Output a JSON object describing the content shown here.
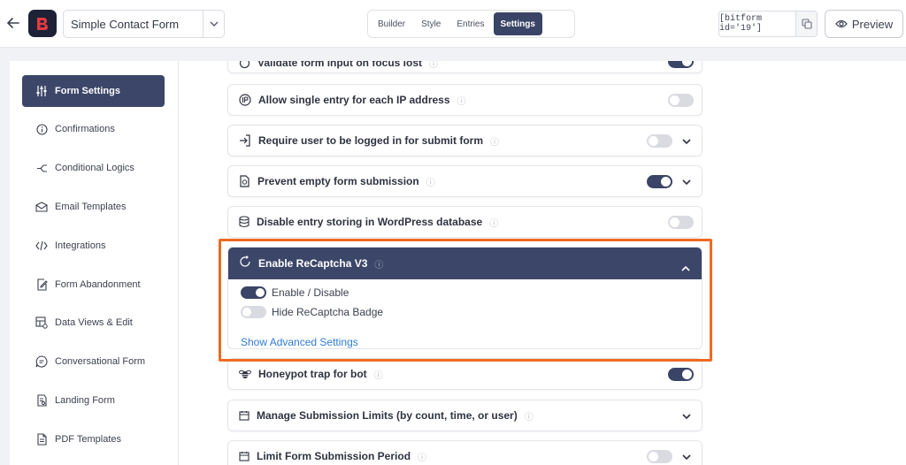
{
  "topbar": {
    "form_name": "Simple Contact Form",
    "tabs": [
      {
        "label": "Builder"
      },
      {
        "label": "Style"
      },
      {
        "label": "Entries"
      },
      {
        "label": "Settings"
      }
    ],
    "active_tab": "Settings",
    "shortcode": "[bitform id='19']",
    "preview_label": "Preview"
  },
  "sidebar": {
    "items": [
      {
        "label": "Form Settings",
        "icon": "sliders-icon"
      },
      {
        "label": "Confirmations",
        "icon": "info-circle-icon"
      },
      {
        "label": "Conditional Logics",
        "icon": "branch-icon"
      },
      {
        "label": "Email Templates",
        "icon": "envelope-icon"
      },
      {
        "label": "Integrations",
        "icon": "code-icon"
      },
      {
        "label": "Form Abandonment",
        "icon": "edit-doc-icon"
      },
      {
        "label": "Data Views & Edit",
        "icon": "table-edit-icon"
      },
      {
        "label": "Conversational Form",
        "icon": "chat-icon"
      },
      {
        "label": "Landing Form",
        "icon": "doc-search-icon"
      },
      {
        "label": "PDF Templates",
        "icon": "pdf-doc-icon"
      }
    ]
  },
  "settings": {
    "validate_label": "Validate form input on focus lost",
    "ip_label": "Allow single entry for each IP address",
    "login_label": "Require user to be logged in for submit form",
    "empty_label": "Prevent empty form submission",
    "storing_label": "Disable entry storing in WordPress database",
    "recaptcha": {
      "title": "Enable ReCaptcha V3",
      "enable_label": "Enable / Disable",
      "enable_on": true,
      "badge_label": "Hide ReCaptcha Badge",
      "badge_on": false,
      "advanced_link": "Show Advanced Settings"
    },
    "honeypot_label": "Honeypot trap for bot",
    "limits_label": "Manage Submission Limits (by count, time, or user)",
    "period_label": "Limit Form Submission Period"
  },
  "colors": {
    "accent": "#3c4669",
    "highlight": "#ee6a22",
    "link": "#2f7bd6"
  }
}
